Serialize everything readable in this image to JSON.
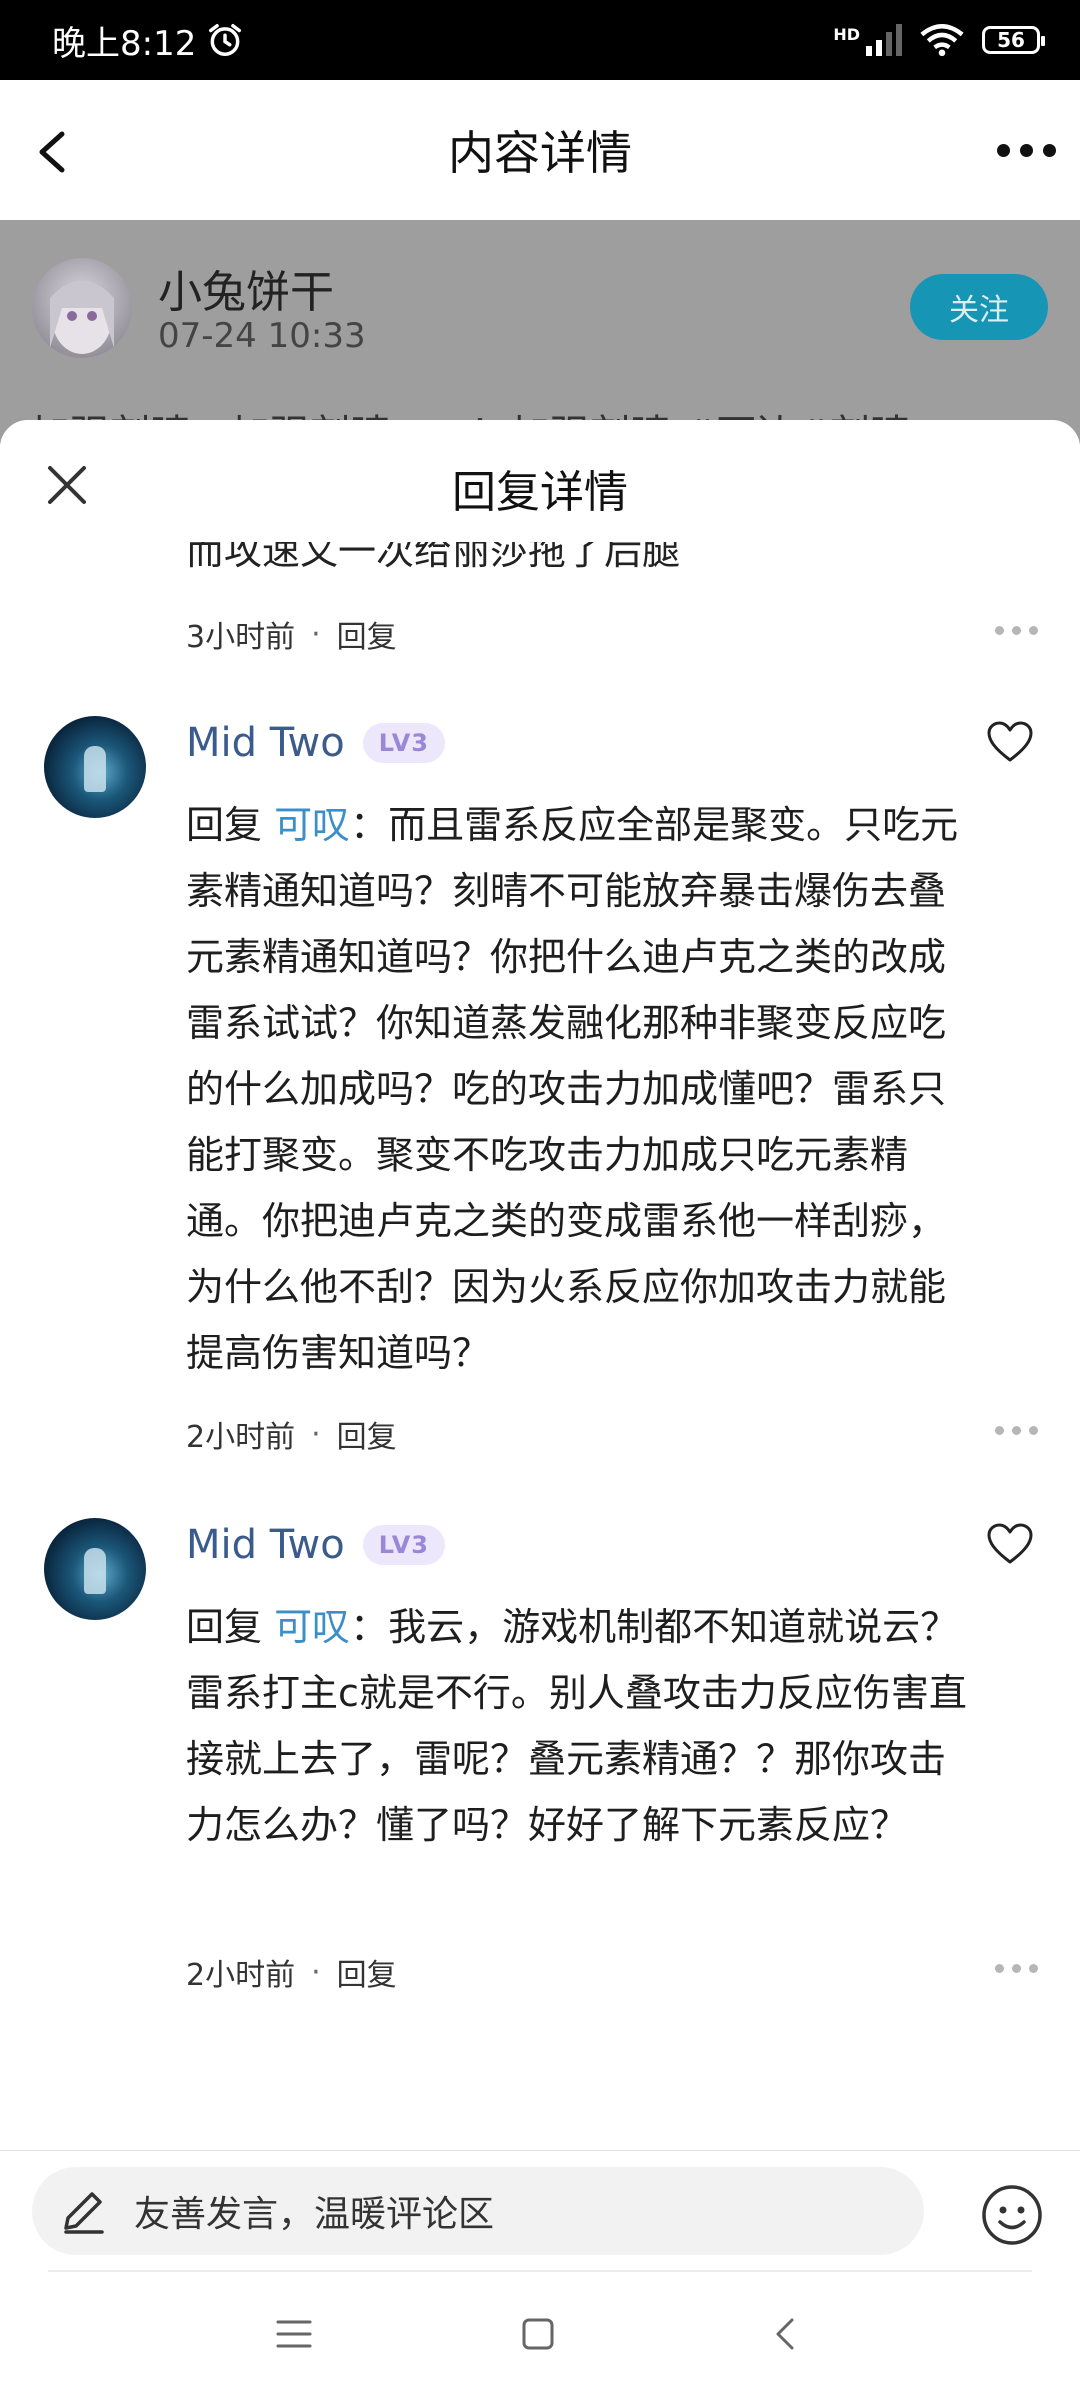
{
  "status_bar": {
    "time": "晚上8:12",
    "network": "HD",
    "battery": "56"
  },
  "header": {
    "title": "内容详情"
  },
  "post": {
    "author": "小兔饼干",
    "time": "07-24 10:33",
    "follow_label": "关注",
    "snippet": "加强刻晴，加强刻晴……！加强刻晴 #两边#刻晴"
  },
  "sheet": {
    "title": "回复详情",
    "prev_comment": {
      "partial_text": "而攻速又一次给丽莎拖了后腿",
      "time": "3小时前",
      "reply_label": "回复"
    },
    "comments": [
      {
        "author": "Mid Two",
        "level": "LV3",
        "reply_prefix": "回复",
        "reply_to": "可叹",
        "separator": "：",
        "text": "而且雷系反应全部是聚变。只吃元素精通知道吗？刻晴不可能放弃暴击爆伤去叠元素精通知道吗？你把什么迪卢克之类的改成雷系试试？你知道蒸发融化那种非聚变反应吃的什么加成吗？吃的攻击力加成懂吧？雷系只能打聚变。聚变不吃攻击力加成只吃元素精通。你把迪卢克之类的变成雷系他一样刮痧，为什么他不刮？因为火系反应你加攻击力就能提高伤害知道吗？",
        "time": "2小时前",
        "reply_label": "回复"
      },
      {
        "author": "Mid Two",
        "level": "LV3",
        "reply_prefix": "回复",
        "reply_to": "可叹",
        "separator": "：",
        "text": "我云，游戏机制都不知道就说云？雷系打主c就是不行。别人叠攻击力反应伤害直接就上去了，雷呢？叠元素精通？？那你攻击力怎么办？懂了吗？好好了解下元素反应？",
        "time": "2小时前",
        "reply_label": "回复"
      }
    ]
  },
  "input": {
    "placeholder": "友善发言，温暖评论区"
  },
  "colors": {
    "accent": "#1795b5",
    "mention": "#3b8fc8",
    "username": "#3a5b8c",
    "level_badge": "#9b87d8"
  }
}
